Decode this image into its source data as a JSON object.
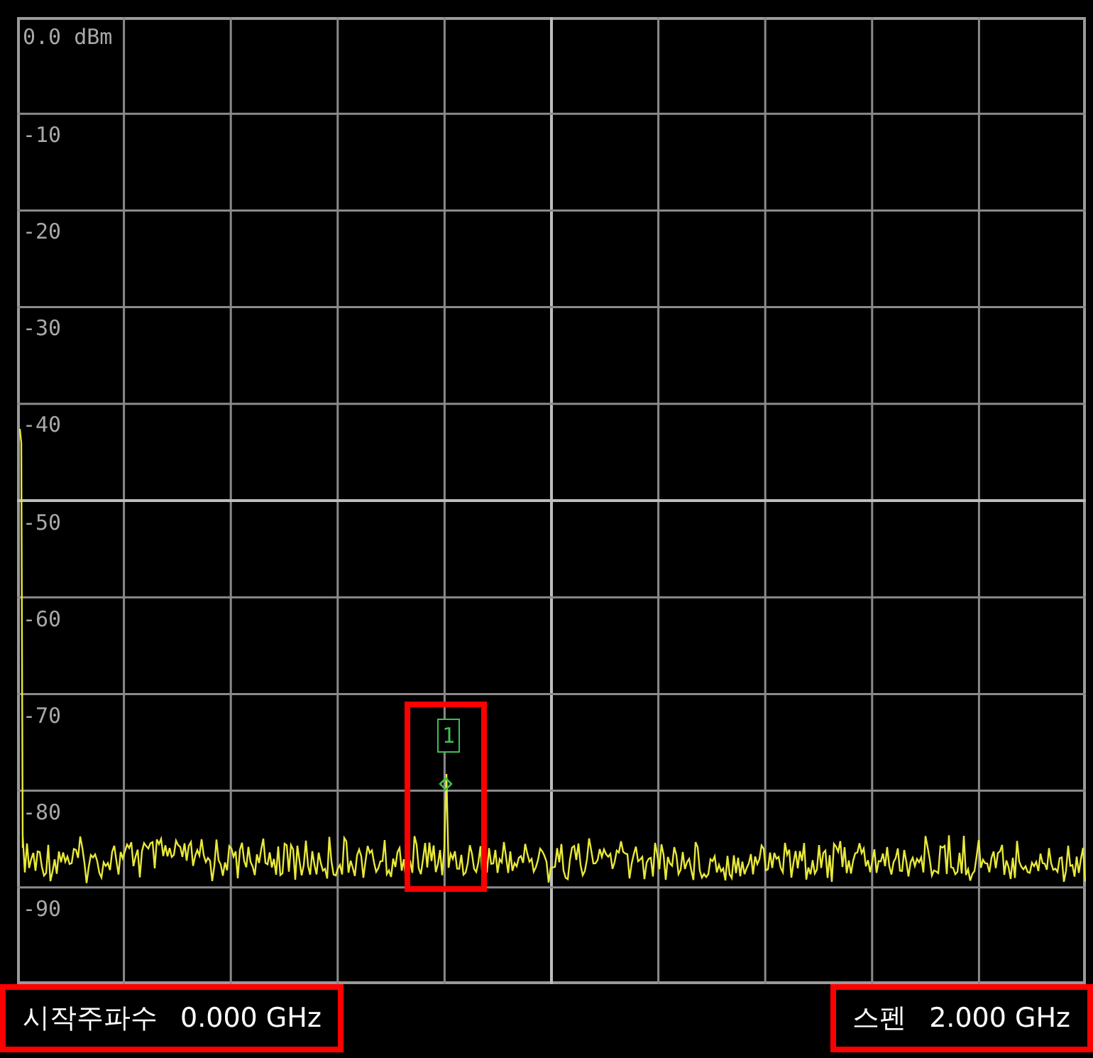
{
  "display": {
    "reference_label": "0.0 dBm",
    "y_labels": [
      "-10",
      "-20",
      "-30",
      "-40",
      "-50",
      "-60",
      "-70",
      "-80",
      "-90"
    ]
  },
  "marker": {
    "label": "1",
    "highlighted": true
  },
  "footer": {
    "start_frequency": {
      "label": "시작주파수",
      "value": "0.000 GHz",
      "highlighted": true
    },
    "span": {
      "label": "스펜",
      "value": "2.000 GHz",
      "highlighted": true
    }
  }
}
